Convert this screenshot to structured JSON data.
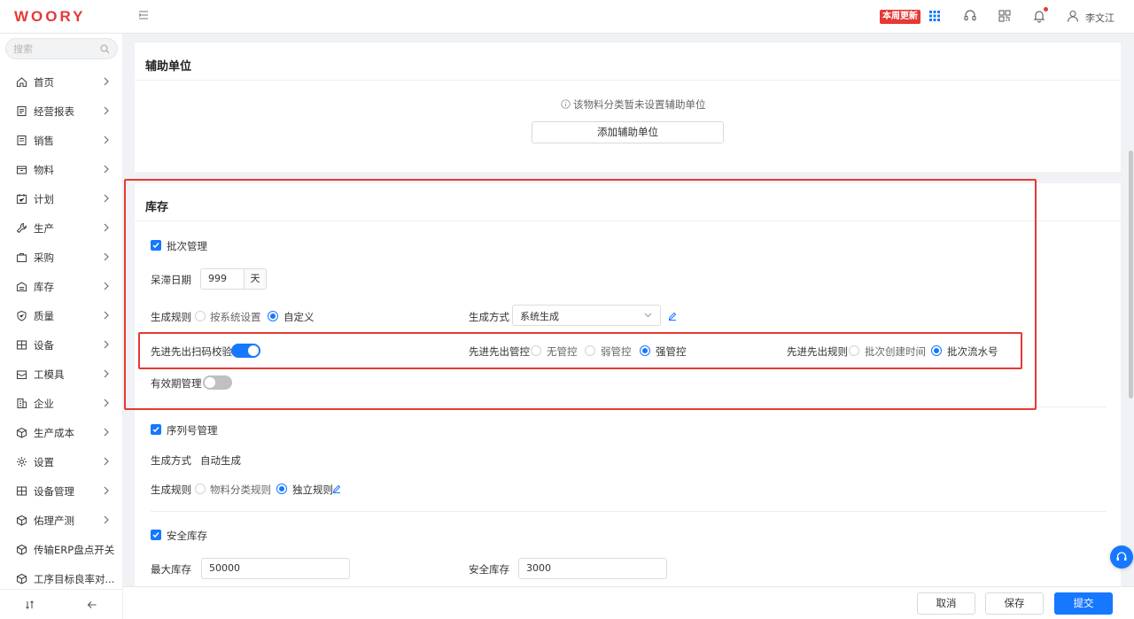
{
  "brand": {
    "logo_text": "WOORY",
    "accent": "#1677ff",
    "alert": "#e53935"
  },
  "topbar": {
    "badge": "本周更新",
    "icons": [
      "apps-grid-icon",
      "headset-icon",
      "qrcode-icon",
      "bell-icon"
    ],
    "user_name": "李文江"
  },
  "sidebar": {
    "search_placeholder": "搜索",
    "items": [
      {
        "label": "首页",
        "icon": "home-icon"
      },
      {
        "label": "经营报表",
        "icon": "report-icon"
      },
      {
        "label": "销售",
        "icon": "document-icon"
      },
      {
        "label": "物料",
        "icon": "box-icon"
      },
      {
        "label": "计划",
        "icon": "calendar-check-icon"
      },
      {
        "label": "生产",
        "icon": "wrench-icon"
      },
      {
        "label": "采购",
        "icon": "bag-icon"
      },
      {
        "label": "库存",
        "icon": "warehouse-icon"
      },
      {
        "label": "质量",
        "icon": "shield-check-icon"
      },
      {
        "label": "设备",
        "icon": "device-icon"
      },
      {
        "label": "工模具",
        "icon": "toolbox-icon"
      },
      {
        "label": "企业",
        "icon": "building-icon"
      },
      {
        "label": "生产成本",
        "icon": "cube-icon"
      },
      {
        "label": "设置",
        "icon": "gear-icon"
      },
      {
        "label": "设备管理",
        "icon": "device-icon"
      },
      {
        "label": "佑理产测",
        "icon": "cube-icon"
      },
      {
        "label": "传输ERP盘点开关",
        "icon": "cube-icon"
      },
      {
        "label": "工序目标良率对...",
        "icon": "cube-icon"
      }
    ]
  },
  "aux_unit": {
    "title": "辅助单位",
    "empty_text": "该物料分类暂未设置辅助单位",
    "add_button": "添加辅助单位"
  },
  "inventory": {
    "title": "库存",
    "batch_mgmt": {
      "label": "批次管理",
      "checked": true
    },
    "stagnant": {
      "label": "呆滞日期",
      "value": "999",
      "unit": "天"
    },
    "gen_rule": {
      "label": "生成规则",
      "options": [
        "按系统设置",
        "自定义"
      ],
      "selected": "自定义"
    },
    "gen_method": {
      "label": "生成方式",
      "value": "系统生成"
    },
    "fifo_scan": {
      "label": "先进先出扫码校验",
      "on": true
    },
    "fifo_control": {
      "label": "先进先出管控",
      "options": [
        "无管控",
        "弱管控",
        "强管控"
      ],
      "selected": "强管控"
    },
    "fifo_rule": {
      "label": "先进先出规则",
      "options": [
        "批次创建时间",
        "批次流水号"
      ],
      "selected": "批次流水号"
    },
    "expiry_mgmt": {
      "label": "有效期管理",
      "on": false
    }
  },
  "serial": {
    "checkbox_label": "序列号管理",
    "method_label": "生成方式",
    "method_value": "自动生成",
    "rule_label": "生成规则",
    "rule_options": [
      "物料分类规则",
      "独立规则"
    ],
    "rule_selected": "独立规则"
  },
  "safety_stock": {
    "checkbox_label": "安全库存",
    "max_label": "最大库存",
    "max_value": "50000",
    "safe_label": "安全库存",
    "safe_value": "3000"
  },
  "actions": {
    "cancel": "取消",
    "save": "保存",
    "submit": "提交"
  }
}
